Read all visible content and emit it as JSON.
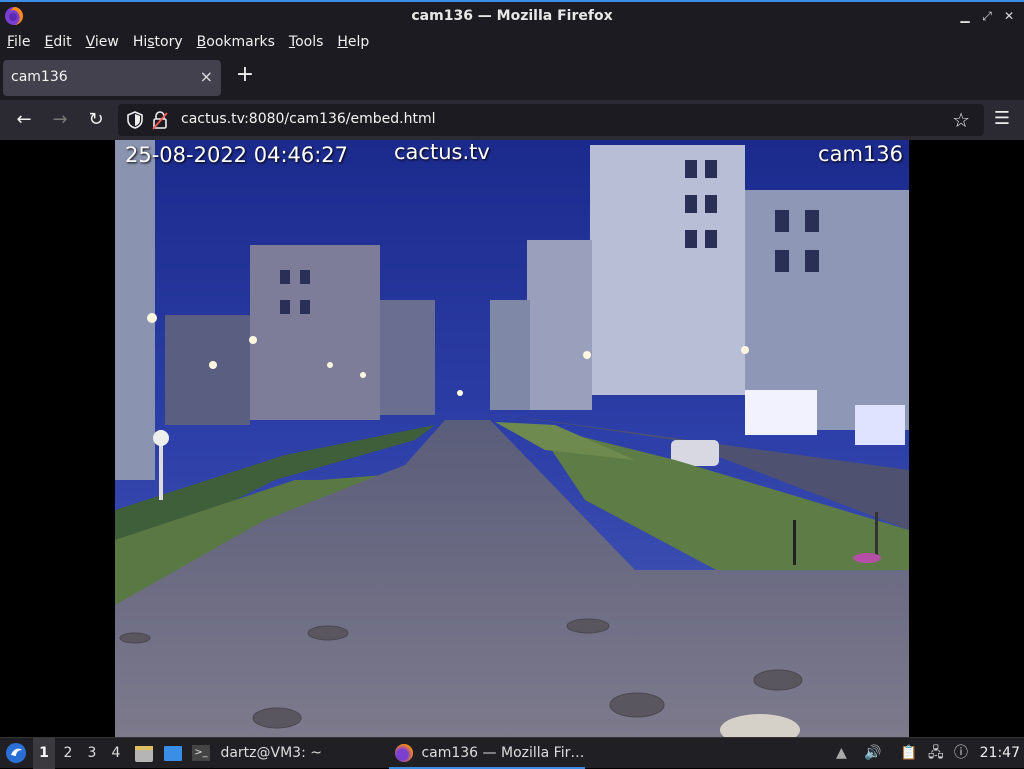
{
  "window": {
    "title": "cam136 — Mozilla Firefox"
  },
  "menu": [
    "File",
    "Edit",
    "View",
    "History",
    "Bookmarks",
    "Tools",
    "Help"
  ],
  "menu_underline": [
    "F",
    "E",
    "V",
    "s",
    "B",
    "T",
    "H"
  ],
  "tab": {
    "label": "cam136",
    "close": "×"
  },
  "navbar": {
    "url": "cactus.tv:8080/cam136/embed.html"
  },
  "video": {
    "timestamp": "25-08-2022 04:46:27",
    "brand": "cactus.tv",
    "camera": "cam136"
  },
  "taskbar": {
    "workspaces": [
      "1",
      "2",
      "3",
      "4"
    ],
    "active_workspace": "1",
    "terminal_task": "dartz@VM3: ~",
    "firefox_task": "cam136 — Mozilla Fir…",
    "clock": "21:47"
  },
  "colors": {
    "accent": "#3a8ee6",
    "chrome_dark": "#1c1b22",
    "toolbar": "#2b2a33"
  }
}
